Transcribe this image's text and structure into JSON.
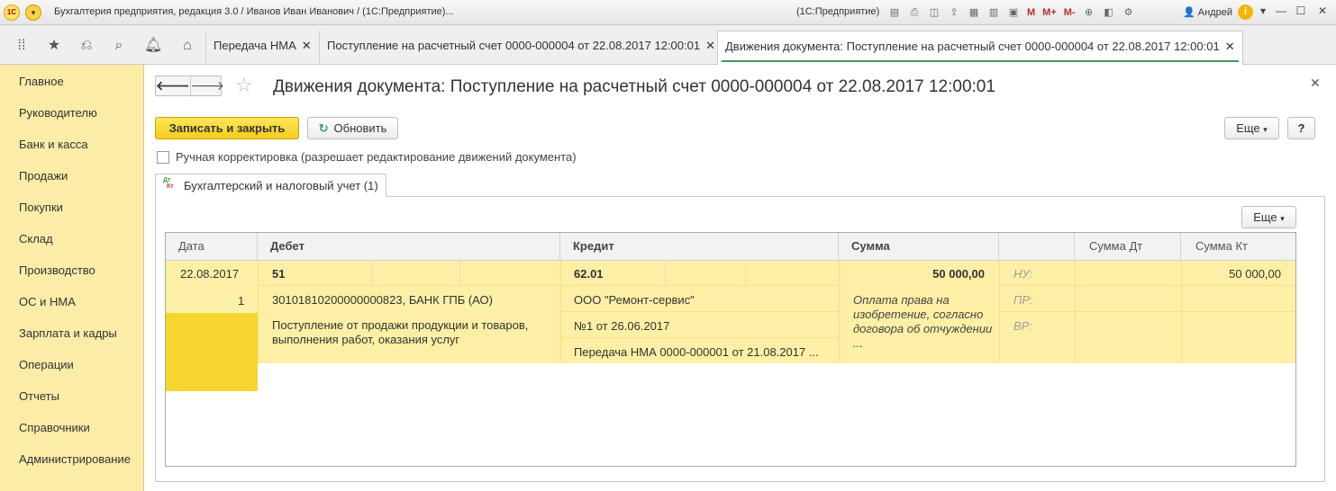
{
  "titlebar": {
    "logo": "1С",
    "title": "Бухгалтерия предприятия, редакция 3.0 / Иванов Иван Иванович / (1С:Предприятие)...",
    "app": "(1С:Предприятие)",
    "user": "Андрей",
    "m_labels": [
      "M",
      "M+",
      "M-"
    ]
  },
  "tabs": [
    {
      "label": "Передача НМА",
      "close": "✕"
    },
    {
      "label": "Поступление на расчетный счет 0000-000004 от 22.08.2017 12:00:01",
      "close": "✕"
    },
    {
      "label": "Движения документа: Поступление на расчетный счет 0000-000004 от 22.08.2017 12:00:01",
      "close": "✕"
    }
  ],
  "sidebar": {
    "items": [
      "Главное",
      "Руководителю",
      "Банк и касса",
      "Продажи",
      "Покупки",
      "Склад",
      "Производство",
      "ОС и НМА",
      "Зарплата и кадры",
      "Операции",
      "Отчеты",
      "Справочники",
      "Администрирование"
    ]
  },
  "form": {
    "title": "Движения документа: Поступление на расчетный счет 0000-000004 от 22.08.2017 12:00:01",
    "save_close": "Записать и закрыть",
    "refresh": "Обновить",
    "more": "Еще",
    "help": "?",
    "manual_label": "Ручная корректировка (разрешает редактирование движений документа)",
    "manual_checked": false,
    "subtab_label": "Бухгалтерский и налоговый учет (1)",
    "subtab_icon_top": "Дт",
    "subtab_icon_bottom": "Кт",
    "grid_more": "Еще"
  },
  "grid": {
    "headers": [
      "Дата",
      "Дебет",
      "Кредит",
      "Сумма",
      "",
      "Сумма Дт",
      "Сумма Кт"
    ],
    "row": {
      "date": "22.08.2017",
      "number": "1",
      "debit_account": "51",
      "debit_sub1": "30101810200000000823, БАНК ГПБ (АО)",
      "debit_sub2": "Поступление от продажи продукции и товаров, выполнения работ, оказания услуг",
      "credit_account": "62.01",
      "credit_sub1": "ООО \"Ремонт-сервис\"",
      "credit_sub2": "№1 от 26.06.2017",
      "credit_sub3": "Передача НМА 0000-000001 от 21.08.2017 ...",
      "amount": "50 000,00",
      "content": "Оплата права на изобретение, согласно договора об отчуждении ...",
      "nu_label": "НУ:",
      "pr_label": "ПР:",
      "vr_label": "ВР:",
      "amount_dt": "",
      "amount_kt": "50 000,00"
    }
  }
}
